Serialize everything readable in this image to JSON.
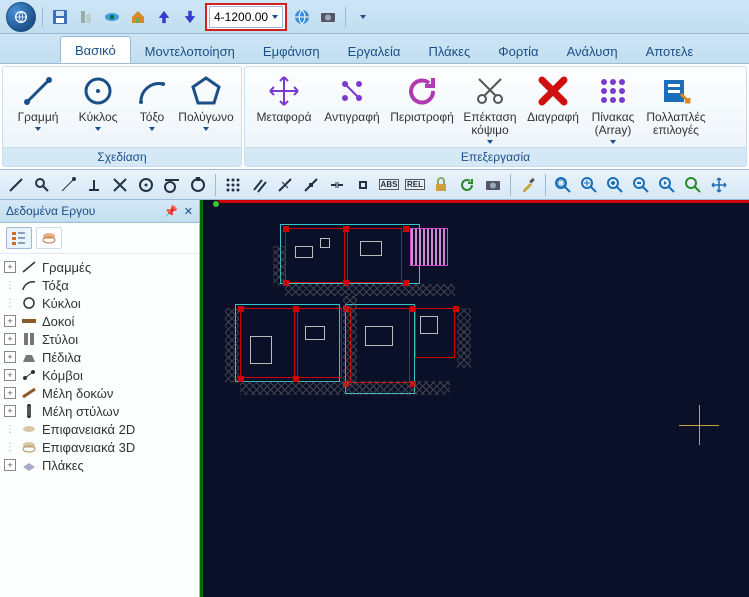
{
  "qat": {
    "level_value": "4-1200.00"
  },
  "tabs": [
    {
      "label": "Βασικό",
      "active": true
    },
    {
      "label": "Μοντελοποίηση"
    },
    {
      "label": "Εμφάνιση"
    },
    {
      "label": "Εργαλεία"
    },
    {
      "label": "Πλάκες"
    },
    {
      "label": "Φορτία"
    },
    {
      "label": "Ανάλυση"
    },
    {
      "label": "Αποτελε"
    }
  ],
  "ribbon": {
    "group_draw": {
      "title": "Σχεδίαση",
      "line": "Γραμμή",
      "circle": "Κύκλος",
      "arc": "Τόξο",
      "polygon": "Πολύγωνο"
    },
    "group_edit": {
      "title": "Επεξεργασία",
      "move": "Μεταφορά",
      "copy": "Αντιγραφή",
      "rotate": "Περιστροφή",
      "extend": "Επέκταση κόψιμο",
      "delete": "Διαγραφή",
      "array": "Πίνακας (Array)",
      "multi": "Πολλαπλές επιλογές"
    }
  },
  "toolstrip_badges": {
    "abs": "ABS",
    "rel": "REL"
  },
  "panel": {
    "title": "Δεδομένα Εργου",
    "tree": [
      {
        "icon": "line",
        "label": "Γραμμές",
        "exp": "+"
      },
      {
        "icon": "arc",
        "label": "Τόξα",
        "exp": "."
      },
      {
        "icon": "circle",
        "label": "Κύκλοι",
        "exp": "."
      },
      {
        "icon": "beam",
        "label": "Δοκοί",
        "exp": "+"
      },
      {
        "icon": "column",
        "label": "Στύλοι",
        "exp": "+"
      },
      {
        "icon": "footing",
        "label": "Πέδιλα",
        "exp": "+"
      },
      {
        "icon": "node",
        "label": "Κόμβοι",
        "exp": "+"
      },
      {
        "icon": "beam-member",
        "label": "Μέλη δοκών",
        "exp": "+"
      },
      {
        "icon": "col-member",
        "label": "Μέλη στύλων",
        "exp": "+"
      },
      {
        "icon": "surf2d",
        "label": "Επιφανειακά 2D",
        "exp": "."
      },
      {
        "icon": "surf3d",
        "label": "Επιφανειακά 3D",
        "exp": "."
      },
      {
        "icon": "slab",
        "label": "Πλάκες",
        "exp": "+"
      }
    ]
  }
}
